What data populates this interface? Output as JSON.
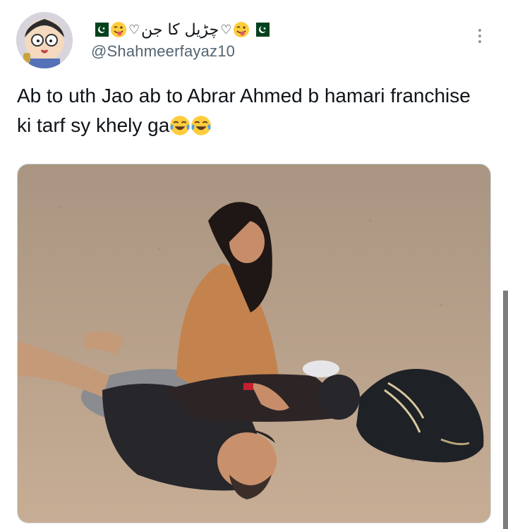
{
  "tweet": {
    "display_name": "چڑیل کا جن",
    "handle": "@Shahmeerfayaz10",
    "text": "Ab to uth Jao ab to Abrar Ahmed b hamari franchise ki tarf sy khely ga",
    "text_emojis": [
      "face-with-tears-of-joy",
      "face-with-tears-of-joy"
    ],
    "name_decorations": [
      "pakistan-flag",
      "winking-face-with-tongue",
      "heart-outline",
      "heart-outline",
      "winking-face-with-tongue",
      "pakistan-flag"
    ]
  },
  "colors": {
    "text": "#0f1419",
    "secondary": "#536471",
    "flag_green": "#01411c",
    "emoji_yellow": "#ffcc3e",
    "sand": "#b99f86"
  },
  "icons": {
    "more": "vertical-ellipsis-icon"
  }
}
